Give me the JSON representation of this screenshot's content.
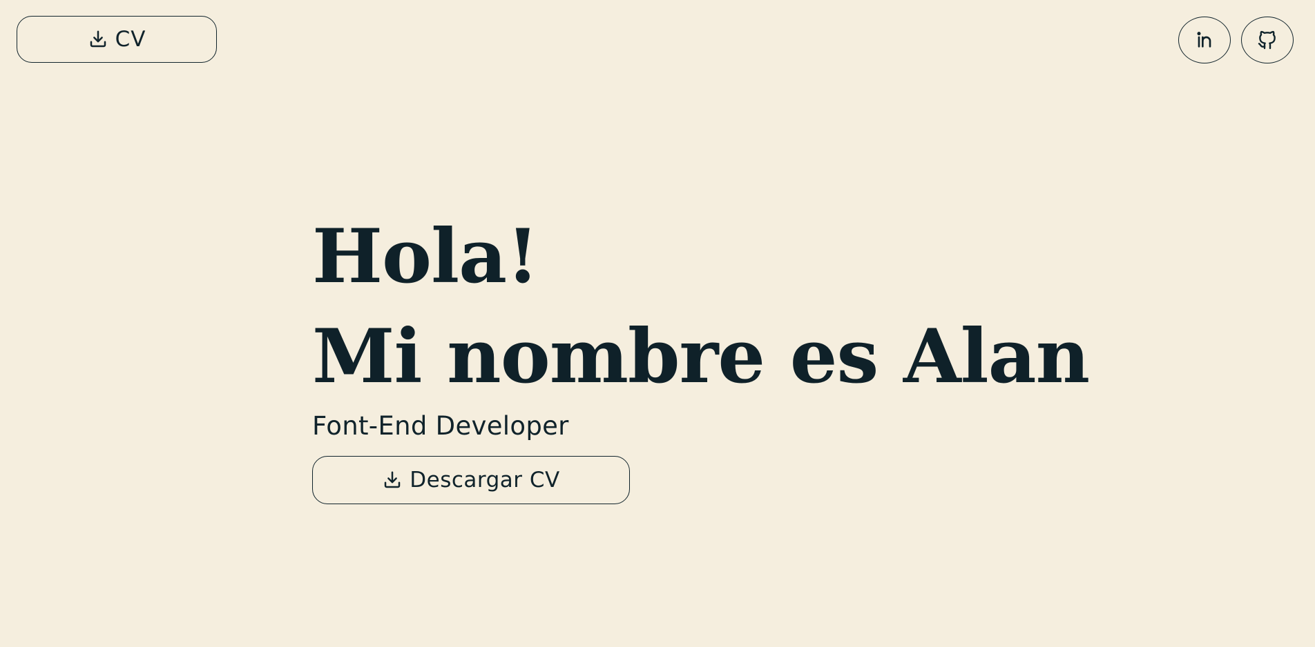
{
  "header": {
    "cv_button": {
      "label": "CV",
      "icon": "download-icon"
    },
    "social": [
      {
        "name": "linkedin",
        "icon": "linkedin-icon"
      },
      {
        "name": "github",
        "icon": "github-icon"
      }
    ]
  },
  "hero": {
    "greeting": "Hola!",
    "name_line": "Mi nombre es Alan",
    "role": "Font-End Developer",
    "cv_button": {
      "label": "Descargar CV",
      "icon": "download-icon"
    }
  },
  "colors": {
    "background": "#f5eede",
    "text": "#10232b"
  }
}
